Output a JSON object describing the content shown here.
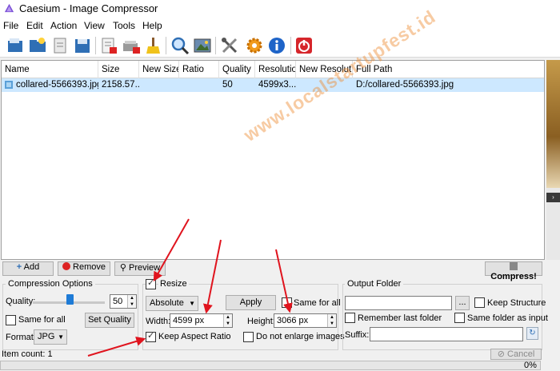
{
  "window": {
    "title": "Caesium - Image Compressor",
    "icon": "caesium-logo-icon"
  },
  "menu": [
    "File",
    "Edit",
    "Action",
    "View",
    "Tools",
    "Help"
  ],
  "toolbar": {
    "icons": [
      "add-pictures-icon",
      "add-folder-icon",
      "save-list-icon",
      "save-icon",
      "remove-items-icon",
      "remove-all-icon",
      "clear-list-icon",
      "zoom-preview-icon",
      "image-preview-icon",
      "settings-tools-icon",
      "preferences-gear-icon",
      "info-icon",
      "exit-power-icon"
    ]
  },
  "table": {
    "columns": [
      "Name",
      "Size",
      "New Size",
      "Ratio",
      "Quality",
      "Resolution",
      "New Resolution",
      "Full Path"
    ],
    "rows": [
      {
        "name": "collared-5566393.jpg",
        "size": "2158.57...",
        "new_size": "",
        "ratio": "",
        "quality": "50",
        "resolution": "4599x3...",
        "new_resolution": "",
        "full_path": "D:/collared-5566393.jpg"
      }
    ]
  },
  "watermark": "www.localstartupfest.id",
  "actions": {
    "add": "Add",
    "remove": "Remove",
    "preview": "Preview",
    "compress": "Compress!"
  },
  "compression": {
    "title": "Compression Options",
    "quality_label": "Quality:",
    "quality_value": "50",
    "quality_fraction": 0.5,
    "same_for_all": "Same for all",
    "set_quality": "Set Quality",
    "format_label": "Format:",
    "format_value": "JPG"
  },
  "resize": {
    "title": "Resize",
    "checked": true,
    "mode": "Absolute",
    "apply": "Apply",
    "same_for_all": "Same for all",
    "width_label": "Width:",
    "width_value": "4599 px",
    "height_label": "Height:",
    "height_value": "3066 px",
    "keep_aspect": "Keep Aspect Ratio",
    "keep_aspect_checked": true,
    "no_enlarge": "Do not enlarge images"
  },
  "output": {
    "title": "Output Folder",
    "browse": "...",
    "keep_structure": "Keep Structure",
    "remember_last": "Remember last folder",
    "same_as_input": "Same folder as input",
    "suffix_label": "Suffix:"
  },
  "status": {
    "item_count": "Item count: 1",
    "cancel": "Cancel",
    "progress": "0%",
    "progress_fraction": 0
  },
  "colors": {
    "selection": "#cde8ff",
    "arrow": "#e0141e",
    "watermark": "#ee8c32"
  }
}
